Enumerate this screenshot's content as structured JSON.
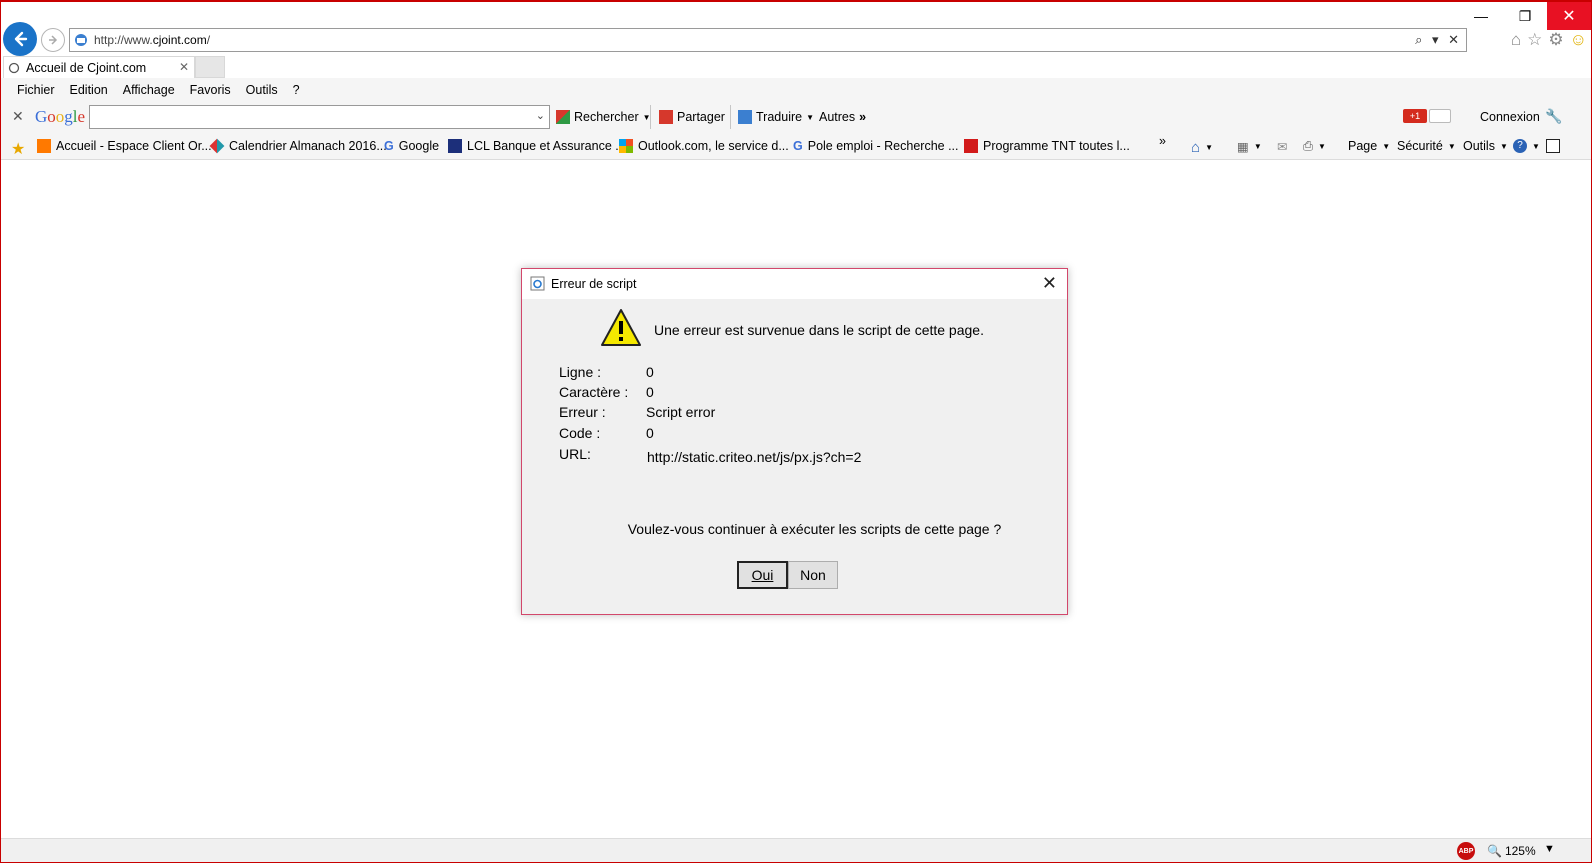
{
  "address": {
    "url_prefix": "http://www.",
    "url_domain": "cjoint.com",
    "url_suffix": "/",
    "tools": "⌕ ▾ ✕"
  },
  "window_controls": {
    "minimize": "—",
    "restore": "❐",
    "close": "✕"
  },
  "tab": {
    "title": "Accueil de Cjoint.com",
    "close": "✕"
  },
  "menu": [
    "Fichier",
    "Edition",
    "Affichage",
    "Favoris",
    "Outils",
    "?"
  ],
  "google_bar": {
    "logo": "Google",
    "search_value": "",
    "rechercher": "Rechercher",
    "partager": "Partager",
    "traduire": "Traduire",
    "autres": "Autres",
    "gplus": "+1",
    "connexion": "Connexion"
  },
  "favorites": [
    "Accueil - Espace Client Or...",
    "Calendrier Almanach 2016...",
    "Google",
    "LCL Banque et Assurance ...",
    "Outlook.com, le service d...",
    "Pole emploi - Recherche ...",
    "Programme TNT  toutes l..."
  ],
  "command_bar": {
    "page": "Page",
    "securite": "Sécurité",
    "outils": "Outils"
  },
  "dialog": {
    "title": "Erreur de script",
    "message": "Une erreur est survenue dans le script de cette page.",
    "fields": [
      {
        "label": "Ligne :",
        "value": "0"
      },
      {
        "label": "Caractère :",
        "value": "0"
      },
      {
        "label": "Erreur :",
        "value": "Script error"
      },
      {
        "label": "Code :",
        "value": "0"
      },
      {
        "label": "URL:",
        "value": "http://static.criteo.net/js/px.js?ch=2"
      }
    ],
    "question": "Voulez-vous continuer à exécuter les scripts de cette page ?",
    "yes": "Oui",
    "no": "Non"
  },
  "status_bar": {
    "abp": "ABP",
    "zoom": "125%"
  },
  "colors": {
    "window_border": "#c80000",
    "dialog_border": "#d2476b",
    "close_red": "#e81123",
    "back_blue": "#1a73c8"
  }
}
